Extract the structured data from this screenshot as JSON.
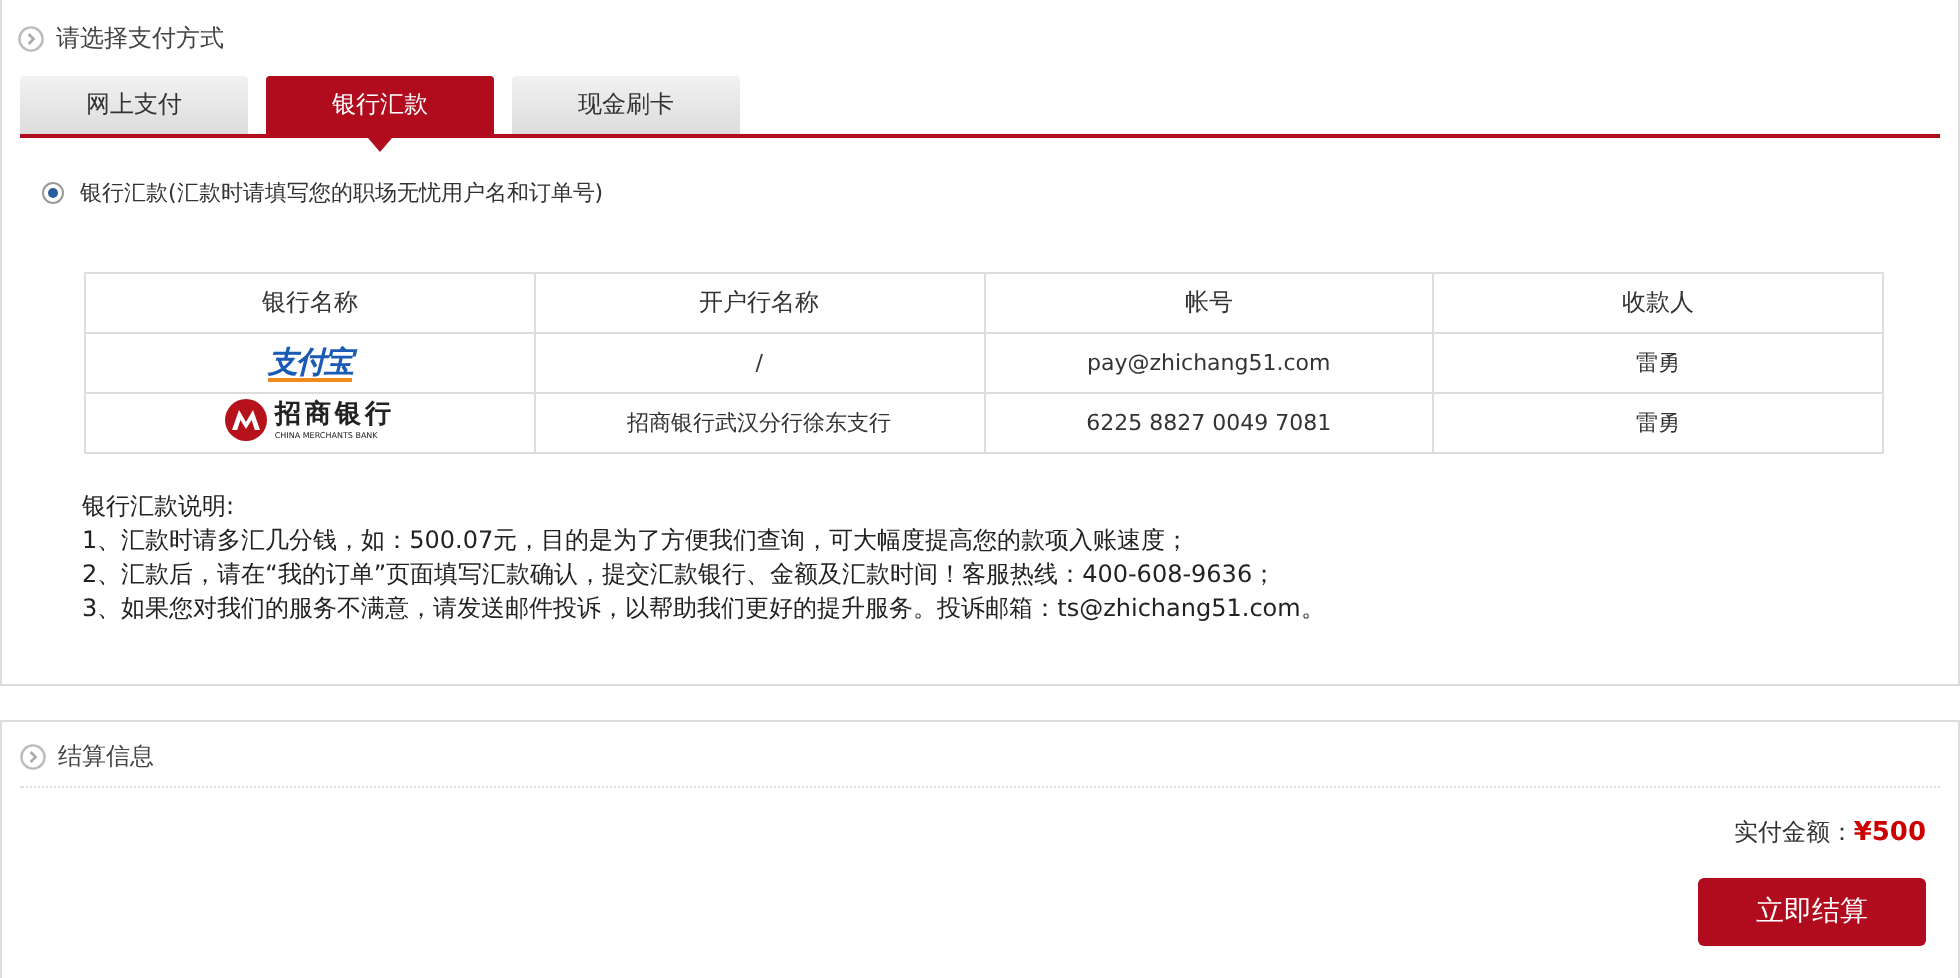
{
  "payment_section": {
    "title": "请选择支付方式",
    "tabs": [
      {
        "label": "网上支付",
        "selected": false
      },
      {
        "label": "银行汇款",
        "selected": true
      },
      {
        "label": "现金刷卡",
        "selected": false
      }
    ],
    "option": {
      "label": "银行汇款(汇款时请填写您的职场无忧用户名和订单号)",
      "selected": true
    },
    "table": {
      "columns": [
        "银行名称",
        "开户行名称",
        "帐号",
        "收款人"
      ],
      "rows": [
        {
          "bank": {
            "kind": "alipay",
            "logo_text": "支付宝"
          },
          "branch": "/",
          "account": "pay@zhichang51.com",
          "payee": "雷勇"
        },
        {
          "bank": {
            "kind": "cmb",
            "logo_text": "招商银行",
            "logo_subtext": "CHINA MERCHANTS BANK"
          },
          "branch": "招商银行武汉分行徐东支行",
          "account": "6225 8827 0049 7081",
          "payee": "雷勇"
        }
      ]
    },
    "notes": [
      "银行汇款说明:",
      "1、汇款时请多汇几分钱，如：500.07元，目的是为了方便我们查询，可大幅度提高您的款项入账速度；",
      "2、汇款后，请在“我的订单”页面填写汇款确认，提交汇款银行、金额及汇款时间！客服热线：400-608-9636；",
      "3、如果您对我们的服务不满意，请发送邮件投诉，以帮助我们更好的提升服务。投诉邮箱：ts@zhichang51.com。"
    ]
  },
  "checkout_section": {
    "title": "结算信息",
    "amount_label": "实付金额：",
    "amount": "¥500",
    "submit_button": "立即结算"
  }
}
